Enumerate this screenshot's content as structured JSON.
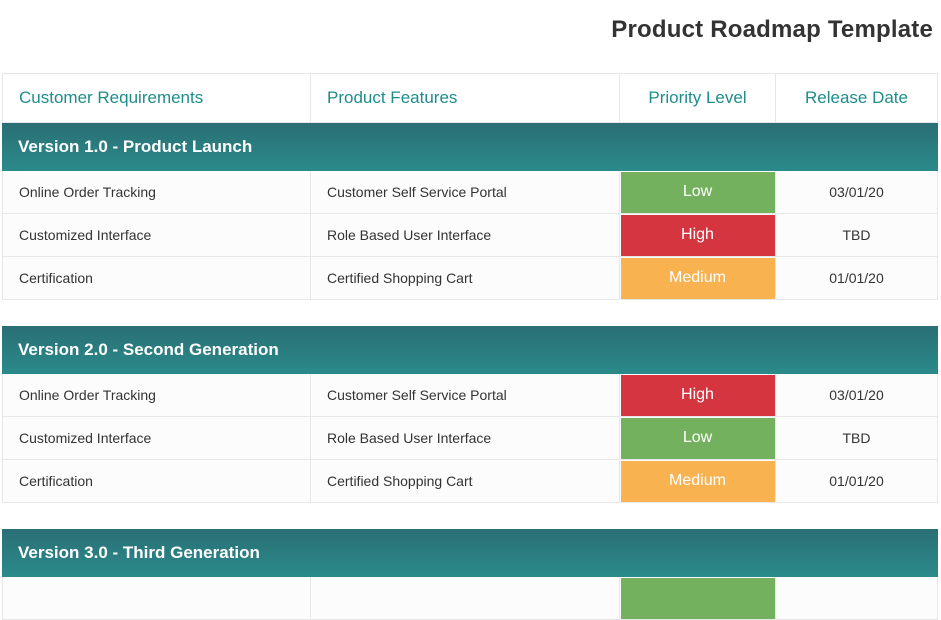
{
  "title": "Product Roadmap Template",
  "columns": [
    "Customer Requirements",
    "Product Features",
    "Priority Level",
    "Release Date"
  ],
  "colors": {
    "Low": "#74b15f",
    "High": "#d5353f",
    "Medium": "#f8b350"
  },
  "sections": [
    {
      "name": "Version 1.0 - Product Launch",
      "rows": [
        {
          "req": "Online Order Tracking",
          "feature": "Customer Self Service Portal",
          "priority": "Low",
          "date": "03/01/20"
        },
        {
          "req": "Customized Interface",
          "feature": "Role Based User Interface",
          "priority": "High",
          "date": "TBD"
        },
        {
          "req": "Certification",
          "feature": "Certified Shopping Cart",
          "priority": "Medium",
          "date": "01/01/20"
        }
      ]
    },
    {
      "name": "Version 2.0 - Second Generation",
      "rows": [
        {
          "req": "Online Order Tracking",
          "feature": "Customer Self Service Portal",
          "priority": "High",
          "date": "03/01/20"
        },
        {
          "req": "Customized Interface",
          "feature": "Role Based User Interface",
          "priority": "Low",
          "date": "TBD"
        },
        {
          "req": "Certification",
          "feature": "Certified Shopping Cart",
          "priority": "Medium",
          "date": "01/01/20"
        }
      ]
    },
    {
      "name": "Version 3.0 - Third Generation",
      "rows": []
    }
  ]
}
